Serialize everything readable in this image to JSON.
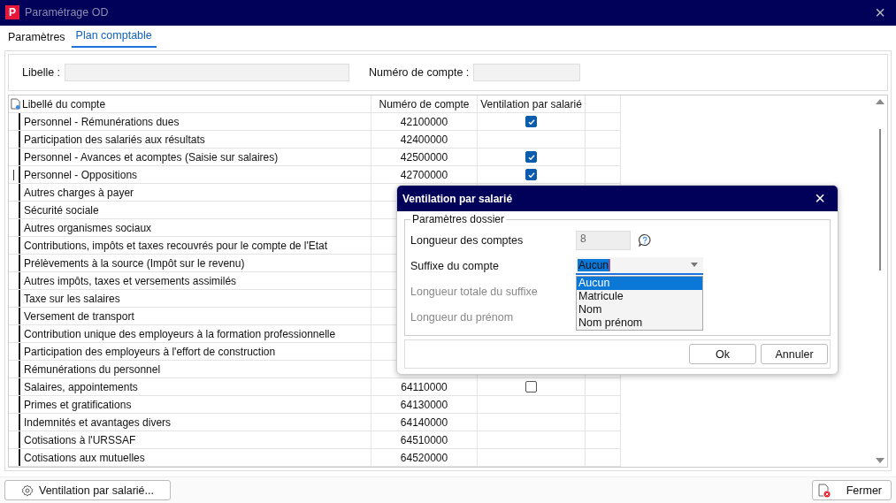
{
  "window": {
    "title": "Paramétrage OD",
    "app_badge": "P",
    "close": "×"
  },
  "tabs": [
    {
      "label": "Paramètres",
      "selected": false
    },
    {
      "label": "Plan comptable",
      "selected": true
    }
  ],
  "filters": [
    {
      "label": "Libelle :"
    },
    {
      "label": "Numéro de compte :"
    }
  ],
  "table": {
    "columns": [
      "Libellé du compte",
      "Numéro de compte",
      "Ventilation par salarié"
    ],
    "rows": [
      {
        "label": "Personnel - Rémunérations dues",
        "number": "42100000",
        "kind": "checkbox",
        "checked": true,
        "selected": false
      },
      {
        "label": "Participation des salariés aux résultats",
        "number": "42400000",
        "kind": "none",
        "selected": false
      },
      {
        "label": "Personnel - Avances et acomptes (Saisie sur salaires)",
        "number": "42500000",
        "kind": "checkbox",
        "checked": true,
        "selected": false
      },
      {
        "label": "Personnel - Oppositions",
        "number": "42700000",
        "kind": "checkbox",
        "checked": true,
        "selected": true
      },
      {
        "label": "Autres charges à payer",
        "kind": "none",
        "selected": false
      },
      {
        "label": "Sécurité sociale",
        "kind": "none",
        "selected": false
      },
      {
        "label": "Autres organismes sociaux",
        "kind": "none",
        "selected": false
      },
      {
        "label": "Contributions, impôts et taxes recouvrés pour le compte de l'Etat",
        "kind": "none",
        "selected": false
      },
      {
        "label": "Prélèvements à la source (Impôt sur le revenu)",
        "kind": "none",
        "selected": false
      },
      {
        "label": "Autres impôts, taxes et versements assimilés",
        "kind": "none",
        "selected": false
      },
      {
        "label": "Taxe sur les salaires",
        "kind": "none",
        "selected": false
      },
      {
        "label": "Versement de transport",
        "kind": "none",
        "selected": false
      },
      {
        "label": "Contribution unique des employeurs à la formation professionnelle",
        "kind": "none",
        "selected": false
      },
      {
        "label": "Participation des employeurs à l'effort de construction",
        "kind": "none",
        "selected": false
      },
      {
        "label": "Rémunérations du personnel",
        "kind": "none",
        "selected": false
      },
      {
        "label": "Salaires, appointements",
        "number": "64110000",
        "kind": "checkbox",
        "checked": false,
        "selected": false
      },
      {
        "label": "Primes et gratifications",
        "number": "64130000",
        "kind": "none",
        "selected": false
      },
      {
        "label": "Indemnités et avantages divers",
        "number": "64140000",
        "kind": "none",
        "selected": false
      },
      {
        "label": "Cotisations à l'URSSAF",
        "number": "64510000",
        "kind": "none",
        "selected": false
      },
      {
        "label": "Cotisations aux mutuelles",
        "number": "64520000",
        "kind": "none",
        "selected": false
      }
    ]
  },
  "footer": {
    "ventilation_button": "Ventilation par salarié...",
    "close_button": "Fermer"
  },
  "dialog": {
    "title": "Ventilation par salarié",
    "close": "×",
    "group": "Paramètres dossier",
    "fields": [
      {
        "label": "Longueur des comptes",
        "kind": "number",
        "value": "8",
        "disabled": false
      },
      {
        "label": "Suffixe du compte",
        "kind": "select",
        "value": "Aucun",
        "disabled": false
      },
      {
        "label": "Longueur totale du suffixe",
        "kind": "blank",
        "disabled": true
      },
      {
        "label": "Longueur du prénom",
        "kind": "blank",
        "disabled": true
      }
    ],
    "options": [
      {
        "label": "Aucun",
        "selected": true
      },
      {
        "label": "Matricule",
        "selected": false
      },
      {
        "label": "Nom",
        "selected": false
      },
      {
        "label": "Nom prénom",
        "selected": false
      }
    ],
    "buttons": [
      "Ok",
      "Annuler"
    ]
  }
}
